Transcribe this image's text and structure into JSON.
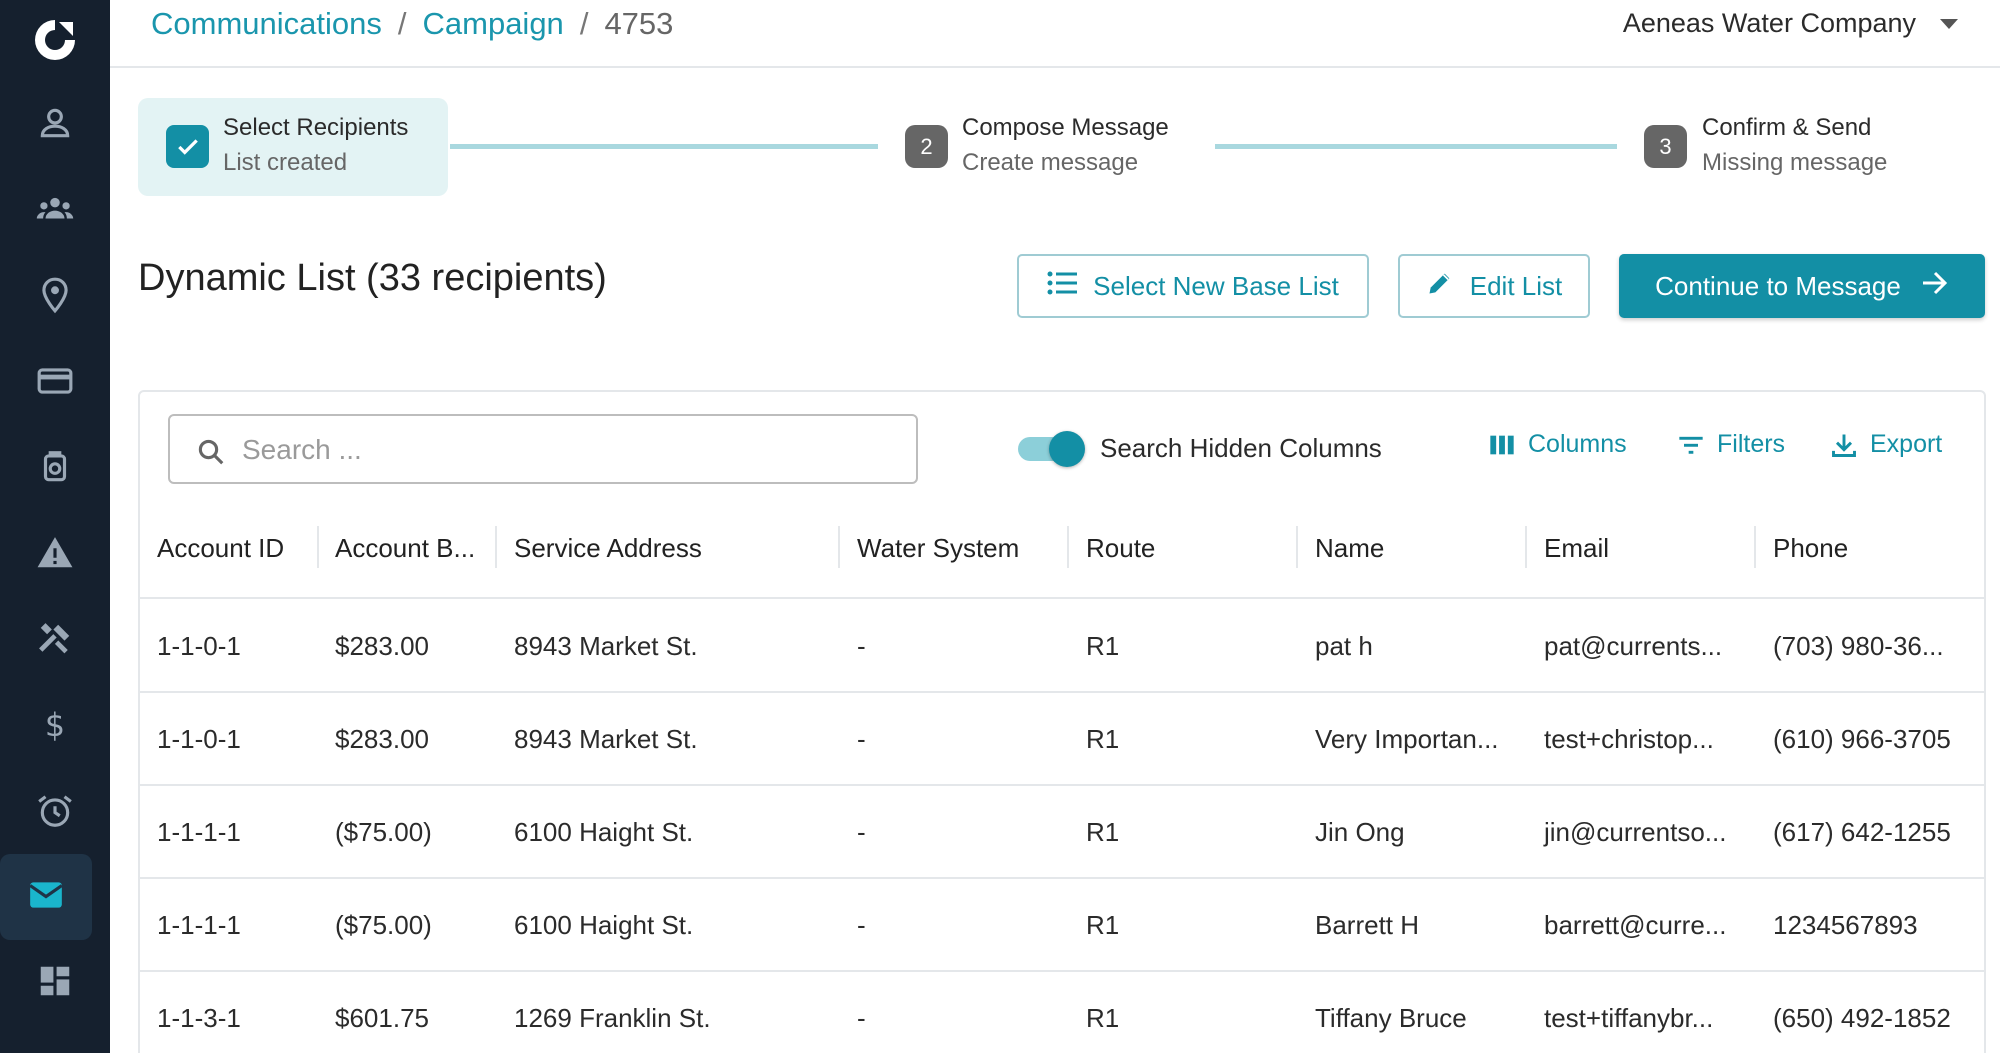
{
  "breadcrumb": {
    "items": [
      "Communications",
      "Campaign"
    ],
    "separator": "/",
    "current": "4753"
  },
  "company": {
    "name": "Aeneas Water Company"
  },
  "sidebar": {
    "items": [
      {
        "icon": "user-icon"
      },
      {
        "icon": "group-icon"
      },
      {
        "icon": "location-pin-icon"
      },
      {
        "icon": "credit-card-icon"
      },
      {
        "icon": "watch-icon"
      },
      {
        "icon": "warning-icon"
      },
      {
        "icon": "tools-icon"
      },
      {
        "icon": "dollar-icon"
      },
      {
        "icon": "alarm-icon"
      },
      {
        "icon": "mail-icon",
        "active": true
      },
      {
        "icon": "dashboard-icon"
      }
    ]
  },
  "stepper": {
    "steps": [
      {
        "title": "Select Recipients",
        "subtitle": "List created",
        "status": "done"
      },
      {
        "number": "2",
        "title": "Compose Message",
        "subtitle": "Create message"
      },
      {
        "number": "3",
        "title": "Confirm & Send",
        "subtitle": "Missing message"
      }
    ]
  },
  "list": {
    "title": "Dynamic List (33 recipients)",
    "select_base_label": "Select New Base List",
    "edit_label": "Edit List",
    "continue_label": "Continue to Message"
  },
  "toolbar": {
    "search_placeholder": "Search ...",
    "toggle_label": "Search Hidden Columns",
    "toggle_on": true,
    "columns_label": "Columns",
    "filters_label": "Filters",
    "export_label": "Export"
  },
  "table": {
    "headers": [
      "Account ID",
      "Account B...",
      "Service Address",
      "Water System",
      "Route",
      "Name",
      "Email",
      "Phone"
    ],
    "rows": [
      [
        "1-1-0-1",
        "$283.00",
        "8943 Market St.",
        "-",
        "R1",
        "pat h",
        "pat@currents...",
        "(703) 980-36..."
      ],
      [
        "1-1-0-1",
        "$283.00",
        "8943 Market St.",
        "-",
        "R1",
        "Very Importan...",
        "test+christop...",
        "(610) 966-3705"
      ],
      [
        "1-1-1-1",
        "($75.00)",
        "6100 Haight St.",
        "-",
        "R1",
        "Jin Ong",
        "jin@currentso...",
        "(617) 642-1255"
      ],
      [
        "1-1-1-1",
        "($75.00)",
        "6100 Haight St.",
        "-",
        "R1",
        "Barrett H",
        "barrett@curre...",
        "1234567893"
      ],
      [
        "1-1-3-1",
        "$601.75",
        "1269 Franklin St.",
        "-",
        "R1",
        "Tiffany Bruce",
        "test+tiffanybr...",
        "(650) 492-1852"
      ]
    ]
  },
  "colors": {
    "sidebar_bg": "#15202e",
    "accent": "#138fa5",
    "step_done_bg": "#e3f3f4"
  }
}
